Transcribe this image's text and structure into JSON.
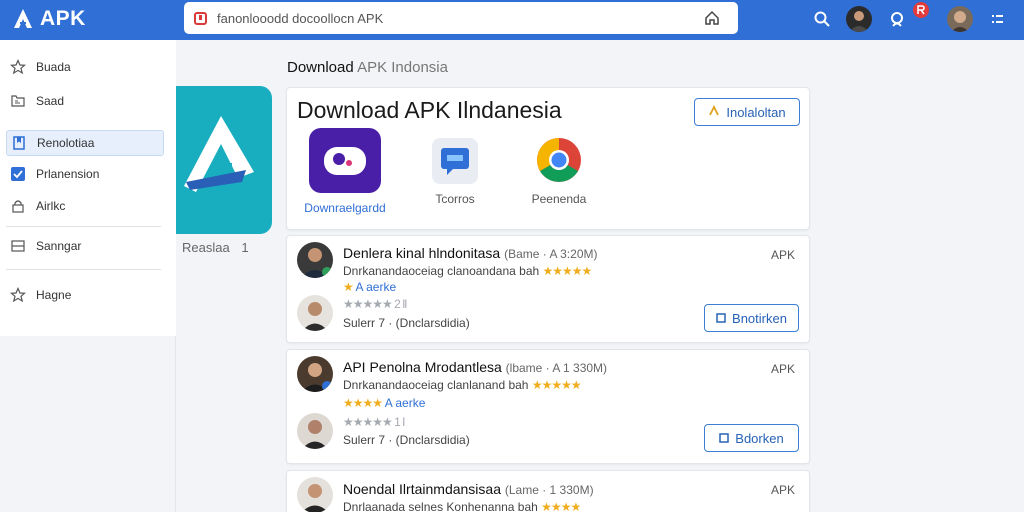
{
  "brand": {
    "name": "APK"
  },
  "search": {
    "value": "fanonlooodd docoollocn APK"
  },
  "sidebar": {
    "items": [
      {
        "label": "Buada"
      },
      {
        "label": "Saad"
      },
      {
        "label": "Renolotiaa"
      },
      {
        "label": "Prlanension"
      },
      {
        "label": "Airlkc"
      },
      {
        "label": "Sanngar"
      },
      {
        "label": "Hagne"
      }
    ]
  },
  "page": {
    "title": "Download",
    "subtitle": "APK Indonsia"
  },
  "banner": {
    "label": "Reaslaa",
    "count": "1"
  },
  "hero": {
    "title": "Download APK Ilndanesia",
    "button_label": "Inolaloltan",
    "apps": [
      {
        "caption": "Downraelgardd"
      },
      {
        "caption": "Tcorros"
      },
      {
        "caption": "Peenenda"
      }
    ]
  },
  "list": [
    {
      "title": "Denlera kinal hlndonitasa",
      "meta": "(Bame · A 3:20M)",
      "tag": "APK",
      "desc": "Dnrkanandaoceiag clanoandana bah",
      "stars_line": "★★★★★",
      "link_text": "A aerke",
      "rating_line": "★★★★★ 2 Il",
      "subline": "Sulerr 7 · (Dnclarsdidia)",
      "button_label": "Bnotirken"
    },
    {
      "title": "API Penolna Mrodantlesa",
      "meta": "(lbame · A 1 330M)",
      "tag": "APK",
      "desc": "Dnrkanandaoceiag clanlanand bah",
      "stars_line": "★★★★★",
      "link_text": "A aerke",
      "rating_line": "★★★★★ 1 I",
      "subline": "Sulerr 7 · (Dnclarsdidia)",
      "button_label": "Bdorken"
    },
    {
      "title": "Noendal Ilrtainmdansisaa",
      "meta": "(Lame · 1 330M)",
      "tag": "APK",
      "desc": "Dnrlaanada selnes Konhenanna bah"
    }
  ],
  "colors": {
    "topbar": "#2f6fd6",
    "accent": "#2f6fd6",
    "star": "#f0ad1e",
    "banner": "#18aec0"
  }
}
